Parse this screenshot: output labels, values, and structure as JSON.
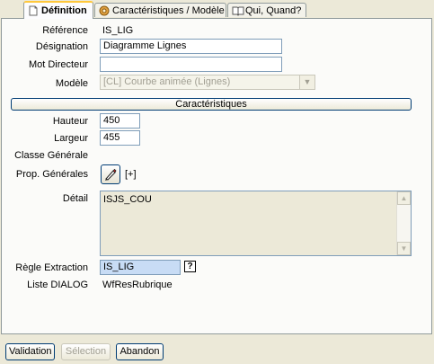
{
  "tabs": [
    {
      "label": "Définition",
      "icon": "page-icon",
      "active": true
    },
    {
      "label": "Caractéristiques / Modèle",
      "icon": "gear-icon",
      "active": false
    },
    {
      "label": "Qui, Quand?",
      "icon": "book-icon",
      "active": false
    }
  ],
  "fields": {
    "reference": {
      "label": "Référence",
      "value": "IS_LIG"
    },
    "designation": {
      "label": "Désignation",
      "value": "Diagramme Lignes"
    },
    "mot_directeur": {
      "label": "Mot Directeur",
      "value": ""
    },
    "modele": {
      "label": "Modèle",
      "value": "[CL] Courbe animée (Lignes)"
    }
  },
  "section_button": "Caractéristiques",
  "caracteristiques": {
    "hauteur": {
      "label": "Hauteur",
      "value": "450"
    },
    "largeur": {
      "label": "Largeur",
      "value": "455"
    },
    "classe_generale": {
      "label": "Classe Générale",
      "value": ""
    },
    "prop_generales": {
      "label": "Prop. Générales",
      "extra": "[+]"
    },
    "detail": {
      "label": "Détail",
      "value": "ISJS_COU"
    },
    "regle_extraction": {
      "label": "Règle Extraction",
      "value": "IS_LIG",
      "help": "?"
    },
    "liste_dialog": {
      "label": "Liste DIALOG",
      "value": "WfResRubrique"
    }
  },
  "buttons": {
    "validation": "Validation",
    "selection": "Sélection",
    "abandon": "Abandon"
  }
}
